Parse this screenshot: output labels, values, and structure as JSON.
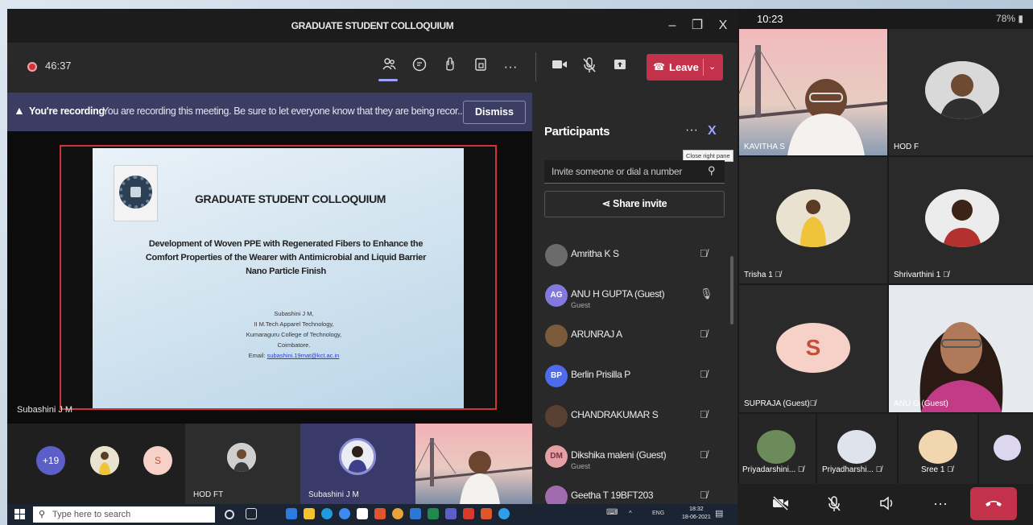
{
  "window": {
    "title": "GRADUATE STUDENT COLLOQUIUM",
    "minimize_glyph": "–",
    "restore_glyph": "❐",
    "close_glyph": "X"
  },
  "toolbar": {
    "recording_time": "46:37",
    "icons": [
      "participants-icon",
      "chat-icon",
      "reactions-icon",
      "rooms-icon",
      "more-icon",
      "camera-icon",
      "mic-off-icon",
      "share-icon"
    ],
    "more_glyph": "···",
    "leave_label": "Leave"
  },
  "banner": {
    "title": "You're recording",
    "text": "You are recording this meeting. Be sure to let everyone know that they are being recor...",
    "dismiss_label": "Dismiss"
  },
  "slide": {
    "title": "GRADUATE STUDENT COLLOQUIUM",
    "subtitle": "Development of Woven PPE with Regenerated Fibers to Enhance the Comfort Properties of the Wearer with Antimicrobial and Liquid Barrier Nano Particle Finish",
    "author_lines": [
      "Subashini J M,",
      "II M.Tech Apparel Technology,",
      "Kumaraguru College of Technology,",
      "Coimbatore."
    ],
    "email_prefix": "Email:",
    "email": "subashini.19mat@kct.ac.in"
  },
  "presenter_name": "Subashini J M",
  "strip": {
    "overflow_count": "+19",
    "s_initial": "S",
    "tile_hod": "HOD FT",
    "tile_subashini": "Subashini J M"
  },
  "participants": {
    "title": "Participants",
    "more_glyph": "···",
    "close_glyph": "X",
    "tooltip": "Close right pane",
    "invite_placeholder": "Invite someone or dial a number",
    "share_label": "Share invite",
    "list": [
      {
        "name": "Amritha K S",
        "initials": "",
        "sub": "",
        "color": "#6b6b6b",
        "mic": "muted"
      },
      {
        "name": "ANU H GUPTA (Guest)",
        "initials": "AG",
        "sub": "Guest",
        "color": "#8378de",
        "mic": "on"
      },
      {
        "name": "ARUNRAJ A",
        "initials": "",
        "sub": "",
        "color": "#7a5a3a",
        "mic": "muted"
      },
      {
        "name": "Berlin Prisilla P",
        "initials": "BP",
        "sub": "",
        "color": "#4f6bed",
        "mic": "muted"
      },
      {
        "name": "CHANDRAKUMAR S",
        "initials": "",
        "sub": "",
        "color": "#5a4030",
        "mic": "muted"
      },
      {
        "name": "Dikshika maleni (Guest)",
        "initials": "DM",
        "sub": "Guest",
        "color": "#e3a1a6",
        "mic": "muted"
      },
      {
        "name": "Geetha T 19BFT203",
        "initials": "",
        "sub": "",
        "color": "#a26bb0",
        "mic": "muted"
      }
    ]
  },
  "taskbar": {
    "search_placeholder": "Type here to search",
    "lang": "ENG",
    "time": "18:32",
    "date": "18-06-2021"
  },
  "phone": {
    "time": "10:23",
    "battery": "78%",
    "tiles": {
      "kavitha": "KAVITHA S",
      "hod": "HOD F",
      "trisha": "Trisha 1",
      "shrivarthini": "Shrivarthini 1",
      "supraja": "SUPRAJA (Guest)",
      "supraja_initial": "S",
      "anu": "ANU G (Guest)"
    },
    "small": [
      "Priyadarshini...",
      "Priyadharshi...",
      "Sree 1"
    ],
    "colors": {
      "accent": "#6264a7",
      "leave": "#c4314b"
    }
  }
}
